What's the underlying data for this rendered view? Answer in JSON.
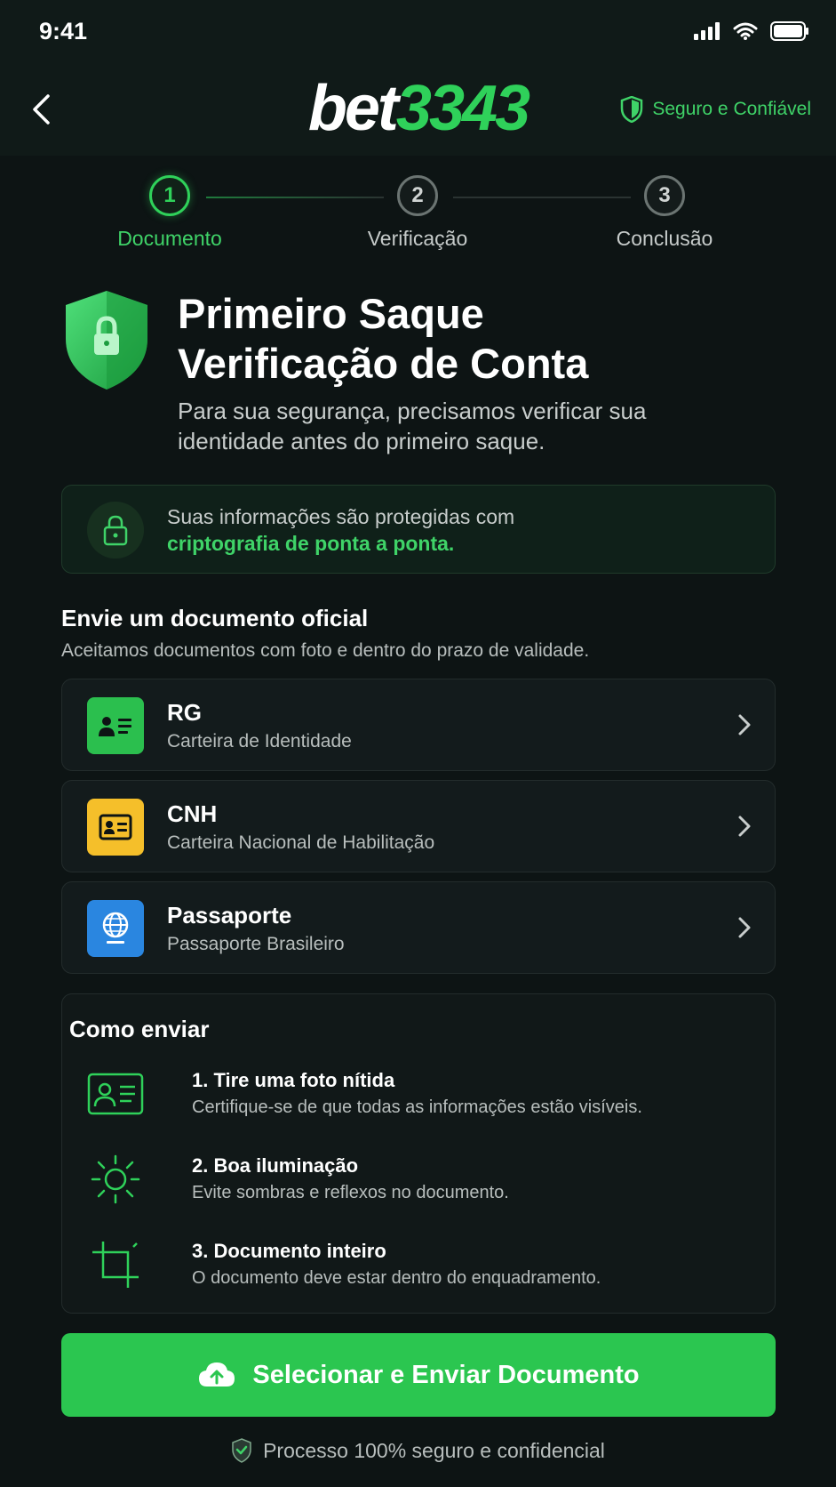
{
  "status_bar": {
    "time": "9:41"
  },
  "header": {
    "logo_white": "bet",
    "logo_green": "3343",
    "trust_label": "Seguro e Confiável"
  },
  "stepper": {
    "steps": [
      {
        "number": "1",
        "label": "Documento",
        "active": true
      },
      {
        "number": "2",
        "label": "Verificação",
        "active": false
      },
      {
        "number": "3",
        "label": "Conclusão",
        "active": false
      }
    ]
  },
  "hero": {
    "title_line1": "Primeiro Saque",
    "title_line2": "Verificação de Conta",
    "subtitle": "Para sua segurança, precisamos verificar sua identidade antes do primeiro saque."
  },
  "secure_notice": {
    "text": "Suas informações são protegidas com",
    "highlight": "criptografia de ponta a ponta."
  },
  "documents_section": {
    "title": "Envie um documento oficial",
    "subtitle": "Aceitamos documentos com foto e dentro do prazo de validade.",
    "items": [
      {
        "title": "RG",
        "subtitle": "Carteira de Identidade",
        "icon": "id-card-icon",
        "color": "#2bbf4e"
      },
      {
        "title": "CNH",
        "subtitle": "Carteira Nacional de Habilitação",
        "icon": "license-icon",
        "color": "#f5bf2a"
      },
      {
        "title": "Passaporte",
        "subtitle": "Passaporte Brasileiro",
        "icon": "globe-icon",
        "color": "#2a86e0"
      }
    ]
  },
  "how_to": {
    "title": "Como enviar",
    "items": [
      {
        "title": "1. Tire uma foto nítida",
        "subtitle": "Certifique-se de que todas as informações estão visíveis.",
        "icon": "id-card-outline-icon"
      },
      {
        "title": "2. Boa iluminação",
        "subtitle": "Evite sombras e reflexos no documento.",
        "icon": "sun-icon"
      },
      {
        "title": "3. Documento inteiro",
        "subtitle": "O documento deve estar dentro do enquadramento.",
        "icon": "crop-icon"
      }
    ]
  },
  "cta": {
    "label": "Selecionar e Enviar Documento"
  },
  "footer": {
    "note": "Processo 100% seguro e confidencial"
  },
  "colors": {
    "accent": "#2fd15a",
    "background": "#0d1414"
  }
}
